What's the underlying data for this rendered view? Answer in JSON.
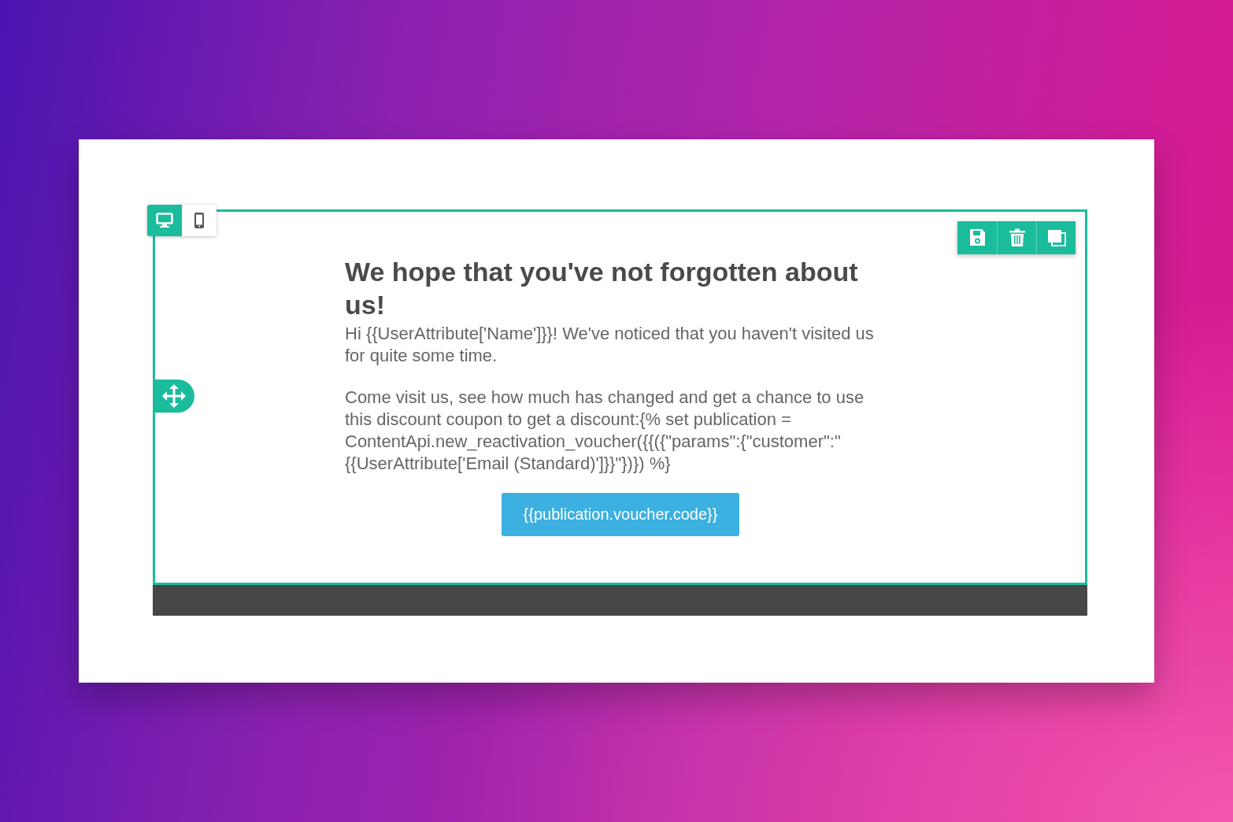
{
  "device_toggle": [
    {
      "kind": "desktop",
      "selected": true
    },
    {
      "kind": "mobile",
      "selected": false
    }
  ],
  "block_tools": [
    {
      "kind": "save"
    },
    {
      "kind": "delete"
    },
    {
      "kind": "duplicate"
    }
  ],
  "email": {
    "heading": "We hope that you've not forgotten about us!",
    "paragraphs": [
      "Hi {{UserAttribute['Name']}}! We've noticed that you haven't visited us for quite some time.",
      "Come visit us, see how much has changed and get a chance to use this discount coupon to get a discount:{% set publication = ContentApi.new_reactivation_voucher({{({\"params\":{\"customer\":\"{{UserAttribute['Email (Standard)']}}\"})}) %}"
    ],
    "button": "{{publication.voucher.code}}"
  }
}
